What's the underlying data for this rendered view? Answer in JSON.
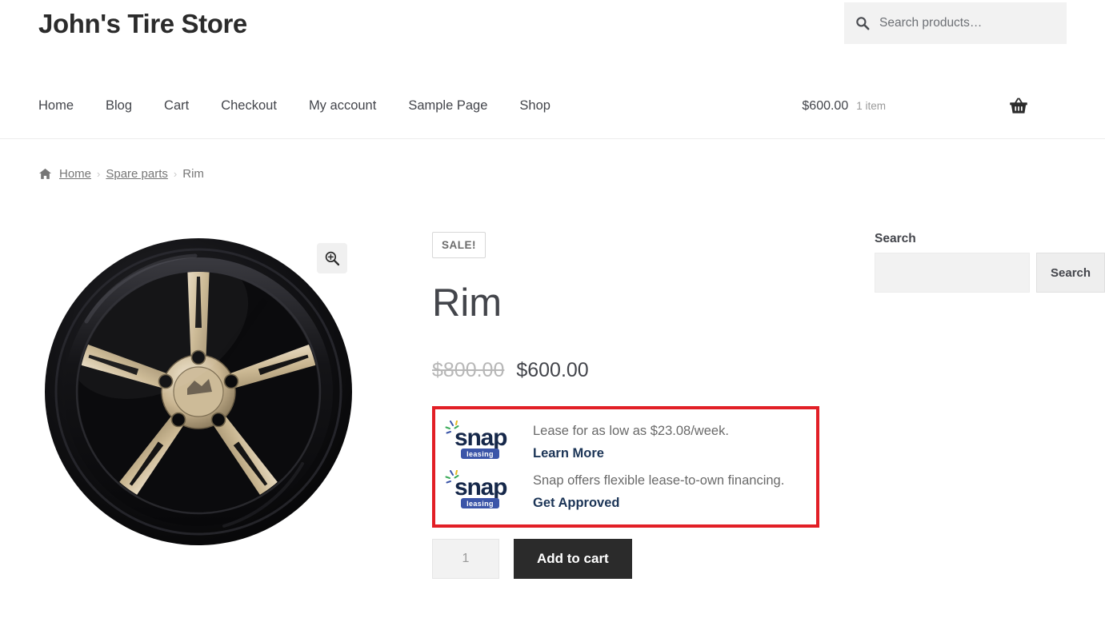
{
  "header": {
    "site_title": "John's Tire Store",
    "search": {
      "placeholder": "Search products…",
      "value": "",
      "icon": "search-icon"
    },
    "nav": [
      {
        "label": "Home"
      },
      {
        "label": "Blog"
      },
      {
        "label": "Cart"
      },
      {
        "label": "Checkout"
      },
      {
        "label": "My account"
      },
      {
        "label": "Sample Page"
      },
      {
        "label": "Shop"
      }
    ],
    "cart": {
      "amount": "$600.00",
      "count": "1 item",
      "icon": "shopping-basket-icon"
    }
  },
  "breadcrumb": {
    "home_icon": "home-icon",
    "items": [
      {
        "label": "Home",
        "link": true
      },
      {
        "label": "Spare parts",
        "link": true
      },
      {
        "label": "Rim",
        "link": false
      }
    ],
    "separator": "›"
  },
  "gallery": {
    "image_alt": "Rim",
    "zoom_icon": "magnifier-plus-icon"
  },
  "product": {
    "sale_badge": "SALE!",
    "title": "Rim",
    "price_old": "$800.00",
    "price_new": "$600.00",
    "quantity": "1",
    "add_to_cart_label": "Add to cart"
  },
  "snap": {
    "border_color": "#e21f26",
    "brand": "snap",
    "brand_sub": "leasing",
    "rows": [
      {
        "text": "Lease for as low as $23.08/week.",
        "cta": "Learn More"
      },
      {
        "text": "Snap offers flexible lease-to-own financing.",
        "cta": "Get Approved"
      }
    ]
  },
  "sidebar": {
    "search_widget": {
      "title": "Search",
      "value": "",
      "placeholder": "",
      "button_label": "Search"
    }
  },
  "colors": {
    "text": "#43454b",
    "muted": "#767676",
    "accent_red": "#e21f26",
    "snap_navy": "#1c3557",
    "snap_blue": "#3b55a8",
    "button_dark": "#2b2b2b"
  }
}
